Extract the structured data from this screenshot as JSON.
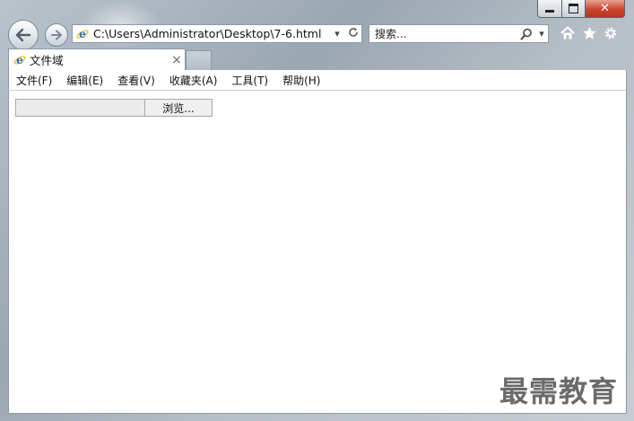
{
  "window": {
    "url": "C:\\Users\\Administrator\\Desktop\\7-6.html",
    "search_placeholder": "搜索...",
    "tab_title": "文件域",
    "tab_close": "×",
    "close_glyph": "✕"
  },
  "menubar": {
    "items": [
      "文件(F)",
      "编辑(E)",
      "查看(V)",
      "收藏夹(A)",
      "工具(T)",
      "帮助(H)"
    ]
  },
  "content": {
    "browse_label": "浏览..."
  },
  "watermark": "最需教育",
  "colors": {
    "frame": "#a9b4be",
    "ie_blue": "#1e73c8",
    "ie_orange": "#f3b515",
    "close_red": "#c9452c"
  },
  "icons": [
    "back-arrow-icon",
    "forward-arrow-icon",
    "ie-logo-icon",
    "dropdown-icon",
    "refresh-icon",
    "search-icon",
    "home-icon",
    "favorites-star-icon",
    "gear-icon",
    "close-icon"
  ]
}
